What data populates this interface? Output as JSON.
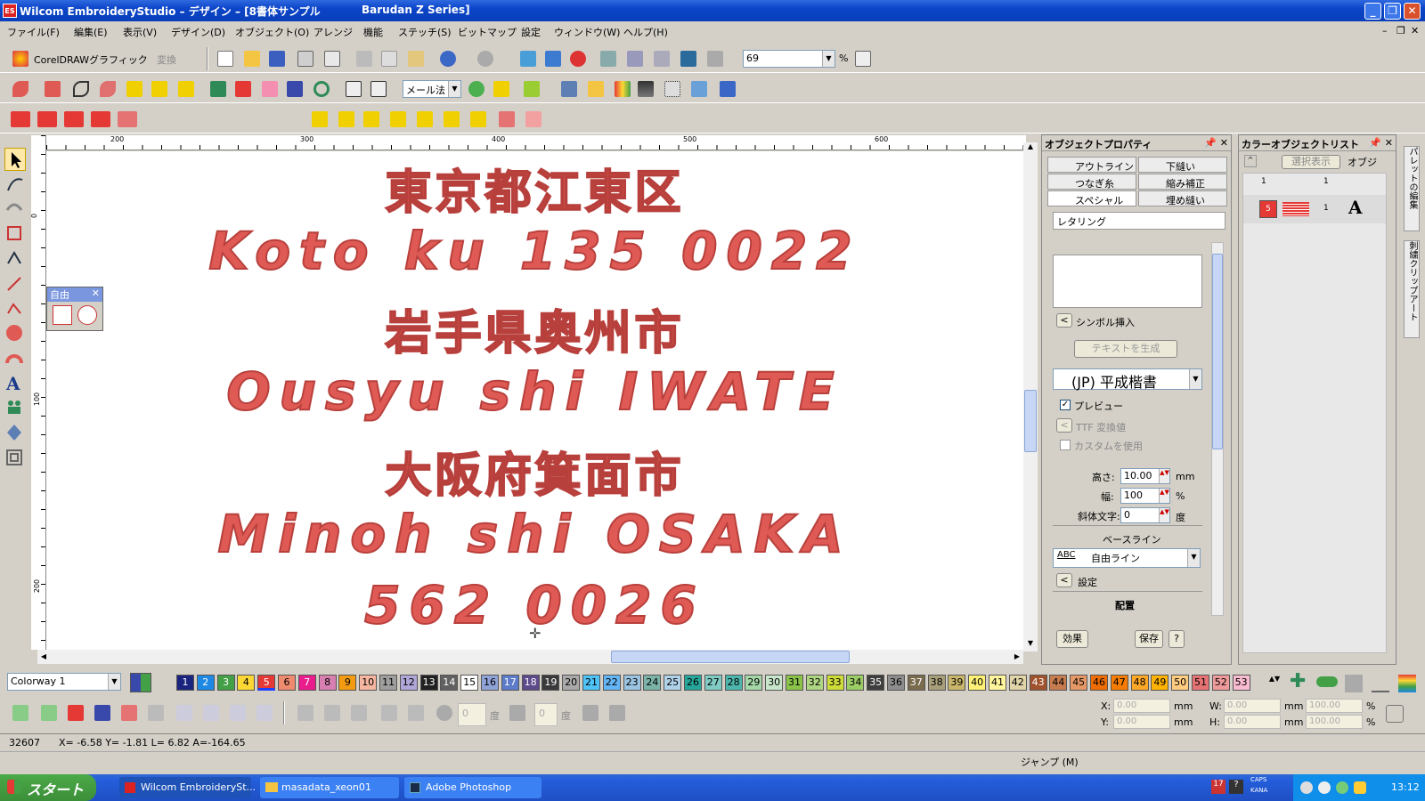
{
  "window": {
    "title": "Wilcom EmbroideryStudio – デザイン – [8書体サンプル",
    "title2": "Barudan Z Series]",
    "app_icon": "ES"
  },
  "menu": [
    "ファイル(F)",
    "編集(E)",
    "表示(V)",
    "デザイン(D)",
    "オブジェクト(O)",
    "アレンジ",
    "機能",
    "ステッチ(S)",
    "ビットマップ",
    "設定",
    "ウィンドウ(W)",
    "ヘルプ(H)"
  ],
  "toolbar": {
    "coreldraw_label": "CorelDRAWグラフィック",
    "convert_label": "変換",
    "zoom_value": "69",
    "zoom_unit": "%",
    "method_value": "メール法"
  },
  "ruler": {
    "top_ticks": [
      "200",
      "300",
      "400",
      "500",
      "600"
    ],
    "left_ticks": [
      "0",
      "100",
      "200"
    ]
  },
  "canvas": {
    "lines": [
      "東京都江東区",
      "Koto ku 135 0022",
      "岩手県奥州市",
      "Ousyu shi IWATE",
      "大阪府箕面市",
      "Minoh shi OSAKA",
      "562 0026"
    ],
    "text_color": "#e05a55"
  },
  "free_panel": {
    "title": "自由"
  },
  "object_properties": {
    "title": "オブジェクトプロパティ",
    "tabs": [
      "アウトライン",
      "下縫い",
      "つなぎ糸",
      "縮み補正",
      "スペシャル",
      "埋め縫い"
    ],
    "type_label": "レタリング",
    "insert_symbol": "シンボル挿入",
    "generate_text": "テキストを生成",
    "font": "(JP) 平成楷書",
    "preview_label": "プレビュー",
    "ttf_label": "TTF 変換値",
    "custom_label": "カスタムを使用",
    "height_label": "高さ:",
    "height_value": "10.00",
    "height_unit": "mm",
    "width_label": "幅:",
    "width_value": "100",
    "width_unit": "%",
    "italic_label": "斜体文字:",
    "italic_value": "0",
    "italic_unit": "度",
    "baseline_label": "ベースライン",
    "baseline_value": "自由ライン",
    "baseline_icon": "ABC",
    "settings_label": "設定",
    "layout_label": "配置",
    "effects_button": "効果",
    "save_button": "保存",
    "help_button": "?"
  },
  "color_object_list": {
    "title": "カラーオブジェクトリスト",
    "select_view": "選択表示",
    "object_col": "オブジ",
    "col1": "1",
    "col2": "1",
    "row_color_num": "5",
    "row_count": "1",
    "row_type": "A"
  },
  "right_strip": [
    "パレットの編集",
    "刺繍クリップアート"
  ],
  "palette": {
    "colorway": "Colorway 1",
    "swatches": [
      {
        "n": "1",
        "c": "#1a237e",
        "t": "#fff"
      },
      {
        "n": "2",
        "c": "#1e88e5",
        "t": "#fff"
      },
      {
        "n": "3",
        "c": "#43a047",
        "t": "#fff"
      },
      {
        "n": "4",
        "c": "#fdd835",
        "t": "#000"
      },
      {
        "n": "5",
        "c": "#e53935",
        "t": "#fff"
      },
      {
        "n": "6",
        "c": "#ef8a6f",
        "t": "#000"
      },
      {
        "n": "7",
        "c": "#e91e8c",
        "t": "#fff"
      },
      {
        "n": "8",
        "c": "#d77fb0",
        "t": "#000"
      },
      {
        "n": "9",
        "c": "#f39c12",
        "t": "#000"
      },
      {
        "n": "10",
        "c": "#f6b6a0",
        "t": "#000"
      },
      {
        "n": "11",
        "c": "#9e9e9e",
        "t": "#000"
      },
      {
        "n": "12",
        "c": "#b0a6d8",
        "t": "#000"
      },
      {
        "n": "13",
        "c": "#212121",
        "t": "#fff"
      },
      {
        "n": "14",
        "c": "#616161",
        "t": "#fff"
      },
      {
        "n": "15",
        "c": "#ffffff",
        "t": "#000"
      },
      {
        "n": "16",
        "c": "#8fa3d8",
        "t": "#000"
      },
      {
        "n": "17",
        "c": "#5c7cc9",
        "t": "#fff"
      },
      {
        "n": "18",
        "c": "#5d4a8a",
        "t": "#fff"
      },
      {
        "n": "19",
        "c": "#3a3a3a",
        "t": "#fff"
      },
      {
        "n": "20",
        "c": "#a9a9a9",
        "t": "#000"
      },
      {
        "n": "21",
        "c": "#4fc3f7",
        "t": "#000"
      },
      {
        "n": "22",
        "c": "#64b5f6",
        "t": "#000"
      },
      {
        "n": "23",
        "c": "#9bc4e2",
        "t": "#000"
      },
      {
        "n": "24",
        "c": "#7bb3a8",
        "t": "#000"
      },
      {
        "n": "25",
        "c": "#b0d2e8",
        "t": "#000"
      },
      {
        "n": "26",
        "c": "#26a69a",
        "t": "#000"
      },
      {
        "n": "27",
        "c": "#80cbc4",
        "t": "#000"
      },
      {
        "n": "28",
        "c": "#4db6ac",
        "t": "#000"
      },
      {
        "n": "29",
        "c": "#a5d6a7",
        "t": "#000"
      },
      {
        "n": "30",
        "c": "#c8e6c9",
        "t": "#000"
      },
      {
        "n": "31",
        "c": "#8bc34a",
        "t": "#000"
      },
      {
        "n": "32",
        "c": "#aed581",
        "t": "#000"
      },
      {
        "n": "33",
        "c": "#cddc39",
        "t": "#000"
      },
      {
        "n": "34",
        "c": "#9ccc65",
        "t": "#000"
      },
      {
        "n": "35",
        "c": "#3e3e3e",
        "t": "#fff"
      },
      {
        "n": "36",
        "c": "#8d8d8d",
        "t": "#000"
      },
      {
        "n": "37",
        "c": "#7a6b4f",
        "t": "#fff"
      },
      {
        "n": "38",
        "c": "#a89f7a",
        "t": "#000"
      },
      {
        "n": "39",
        "c": "#c9b66b",
        "t": "#000"
      },
      {
        "n": "40",
        "c": "#fff176",
        "t": "#000"
      },
      {
        "n": "41",
        "c": "#fff59d",
        "t": "#000"
      },
      {
        "n": "42",
        "c": "#e0d4a8",
        "t": "#000"
      },
      {
        "n": "43",
        "c": "#a0522d",
        "t": "#fff"
      },
      {
        "n": "44",
        "c": "#c67c4e",
        "t": "#000"
      },
      {
        "n": "45",
        "c": "#e59866",
        "t": "#000"
      },
      {
        "n": "46",
        "c": "#ef6c00",
        "t": "#000"
      },
      {
        "n": "47",
        "c": "#f57c00",
        "t": "#000"
      },
      {
        "n": "48",
        "c": "#ffa726",
        "t": "#000"
      },
      {
        "n": "49",
        "c": "#ffb300",
        "t": "#000"
      },
      {
        "n": "50",
        "c": "#ffcc80",
        "t": "#000"
      },
      {
        "n": "51",
        "c": "#e57373",
        "t": "#000"
      },
      {
        "n": "52",
        "c": "#ef9a9a",
        "t": "#000"
      },
      {
        "n": "53",
        "c": "#f8bbd0",
        "t": "#000"
      }
    ]
  },
  "coords": {
    "x_label": "X:",
    "x_value": "0.00",
    "y_label": "Y:",
    "y_value": "0.00",
    "w_label": "W:",
    "w_value": "0.00",
    "h_label": "H:",
    "h_value": "0.00",
    "unit": "mm",
    "pct_w": "100.00",
    "pct_h": "100.00",
    "pct": "%",
    "deg_unit": "度"
  },
  "status": {
    "stitch_count": "32607",
    "position": "X= -6.58 Y= -1.81 L= 6.82 A=-164.65",
    "jump": "ジャンプ (M)"
  },
  "taskbar": {
    "start": "スタート",
    "tasks": [
      "Wilcom EmbroiderySt...",
      "masadata_xeon01",
      "Adobe Photoshop"
    ],
    "caps": "CAPS",
    "kana": "KANA",
    "time": "13:12"
  }
}
